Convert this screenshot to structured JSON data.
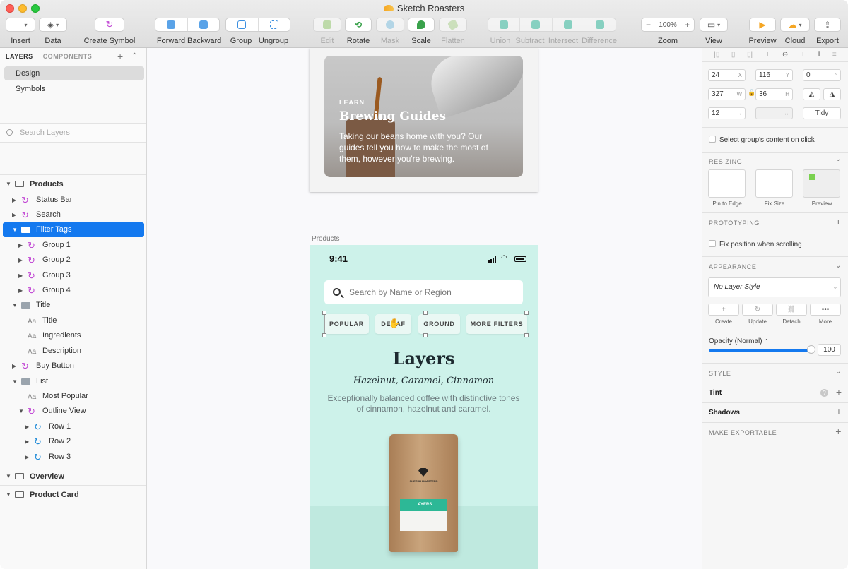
{
  "window": {
    "title": "Sketch Roasters"
  },
  "toolbar": {
    "insert": "Insert",
    "data": "Data",
    "create_symbol": "Create Symbol",
    "forward": "Forward",
    "backward": "Backward",
    "group": "Group",
    "ungroup": "Ungroup",
    "edit": "Edit",
    "rotate": "Rotate",
    "mask": "Mask",
    "scale": "Scale",
    "flatten": "Flatten",
    "union": "Union",
    "subtract": "Subtract",
    "intersect": "Intersect",
    "difference": "Difference",
    "zoom_value": "100%",
    "zoom": "Zoom",
    "view": "View",
    "preview": "Preview",
    "cloud": "Cloud",
    "export": "Export"
  },
  "left": {
    "tab_layers": "LAYERS",
    "tab_components": "COMPONENTS",
    "pages": [
      "Design",
      "Symbols"
    ],
    "search_placeholder": "Search Layers",
    "layers": [
      "Products",
      "Status Bar",
      "Search",
      "Filter Tags",
      "Group 1",
      "Group 2",
      "Group 3",
      "Group 4",
      "Title",
      "Title",
      "Ingredients",
      "Description",
      "Buy Button",
      "List",
      "Most Popular",
      "Outline View",
      "Row 1",
      "Row 2",
      "Row 3",
      "Overview",
      "Product Card"
    ],
    "text_glyph": "Aa"
  },
  "canvas": {
    "card": {
      "eyebrow": "LEARN",
      "title": "Brewing Guides",
      "body": "Taking our beans home with you? Our guides tell you how to make the most of them, however you're brewing."
    },
    "artboard_label": "Products",
    "phone": {
      "time": "9:41",
      "search_placeholder": "Search by Name or Region",
      "chips": [
        "POPULAR",
        "DECAF",
        "GROUND",
        "MORE FILTERS"
      ],
      "title": "Layers",
      "subtitle": "Hazelnut, Caramel, Cinnamon",
      "description": "Exceptionally balanced coffee with distinctive tones of cinnamon, hazelnut and caramel.",
      "bag_brand": "SKETCH ROASTERS",
      "bag_label": "LAYERS"
    }
  },
  "right": {
    "x": "24",
    "x_unit": "X",
    "y": "116",
    "y_unit": "Y",
    "rotation": "0",
    "rotation_unit": "°",
    "w": "327",
    "w_unit": "W",
    "h": "36",
    "h_unit": "H",
    "spacing": "12",
    "tidy": "Tidy",
    "select_group_content": "Select group's content on click",
    "resizing": "RESIZING",
    "pin_to_edge": "Pin to Edge",
    "fix_size": "Fix Size",
    "preview": "Preview",
    "prototyping": "PROTOTYPING",
    "fix_position": "Fix position when scrolling",
    "appearance": "APPEARANCE",
    "layer_style": "No Layer Style",
    "create": "Create",
    "update": "Update",
    "detach": "Detach",
    "more": "More",
    "opacity_label": "Opacity (Normal)",
    "opacity_value": "100",
    "style": "STYLE",
    "tint": "Tint",
    "shadows": "Shadows",
    "make_exportable": "MAKE EXPORTABLE"
  },
  "colors": {
    "accent": "#1479ef",
    "symbol": "#c147d4",
    "mint": "#cdf2ea",
    "label_green": "#2db896"
  }
}
